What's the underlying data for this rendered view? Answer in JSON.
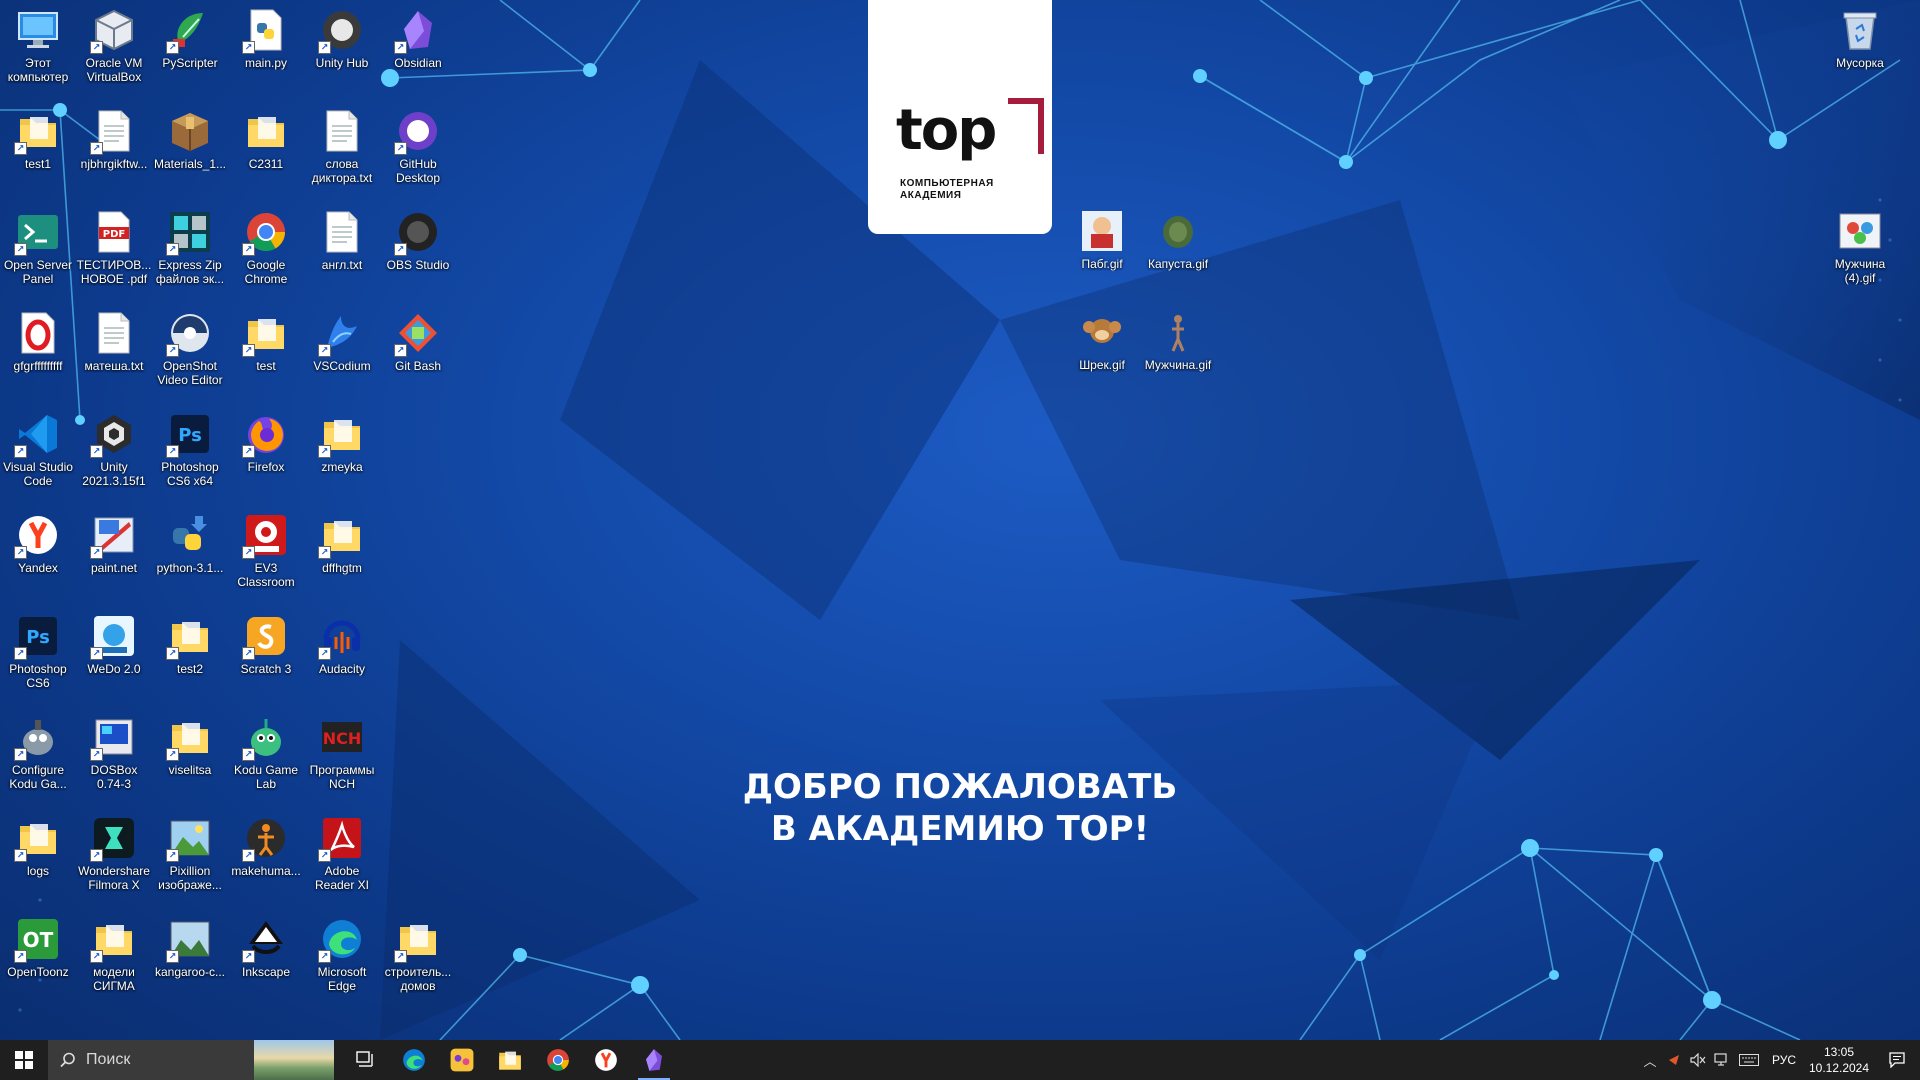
{
  "logo": {
    "word": "top",
    "subtitle_line1": "КОМПЬЮТЕРНАЯ",
    "subtitle_line2": "АКАДЕМИЯ",
    "accent": "#a61c3c"
  },
  "welcome": {
    "line1": "ДОБРО ПОЖАЛОВАТЬ",
    "line2": "В АКАДЕМИЮ TOP!"
  },
  "desktop_icons": [
    {
      "label": "Этот компьютер",
      "icon": "computer-icon",
      "col": 0,
      "row": 0,
      "shortcut": false
    },
    {
      "label": "Oracle VM VirtualBox",
      "icon": "virtualbox-icon",
      "col": 1,
      "row": 0,
      "shortcut": true
    },
    {
      "label": "PyScripter",
      "icon": "pyscripter-icon",
      "col": 2,
      "row": 0,
      "shortcut": true
    },
    {
      "label": "main.py",
      "icon": "python-file-icon",
      "col": 3,
      "row": 0,
      "shortcut": true
    },
    {
      "label": "Unity Hub",
      "icon": "unity-hub-icon",
      "col": 4,
      "row": 0,
      "shortcut": true
    },
    {
      "label": "Obsidian",
      "icon": "obsidian-icon",
      "col": 5,
      "row": 0,
      "shortcut": true
    },
    {
      "label": "test1",
      "icon": "folder-icon",
      "col": 0,
      "row": 1,
      "shortcut": true
    },
    {
      "label": "njbhrgikftw...",
      "icon": "document-icon",
      "col": 1,
      "row": 1,
      "shortcut": true
    },
    {
      "label": "Materials_1...",
      "icon": "archive-icon",
      "col": 2,
      "row": 1,
      "shortcut": false
    },
    {
      "label": "C2311",
      "icon": "folder-icon",
      "col": 3,
      "row": 1,
      "shortcut": false
    },
    {
      "label": "слова диктора.txt",
      "icon": "text-file-icon",
      "col": 4,
      "row": 1,
      "shortcut": false
    },
    {
      "label": "GitHub Desktop",
      "icon": "github-icon",
      "col": 5,
      "row": 1,
      "shortcut": true
    },
    {
      "label": "Open Server Panel",
      "icon": "terminal-icon",
      "col": 0,
      "row": 2,
      "shortcut": true
    },
    {
      "label": "ТЕСТИРОВ... НОВОЕ .pdf",
      "icon": "pdf-icon",
      "col": 1,
      "row": 2,
      "shortcut": false
    },
    {
      "label": "Express Zip файлов эк...",
      "icon": "zip-icon",
      "col": 2,
      "row": 2,
      "shortcut": true
    },
    {
      "label": "Google Chrome",
      "icon": "chrome-icon",
      "col": 3,
      "row": 2,
      "shortcut": true
    },
    {
      "label": "англ.txt",
      "icon": "text-file-icon",
      "col": 4,
      "row": 2,
      "shortcut": false
    },
    {
      "label": "OBS Studio",
      "icon": "obs-icon",
      "col": 5,
      "row": 2,
      "shortcut": true
    },
    {
      "label": "gfgrfffffffff",
      "icon": "opera-icon",
      "col": 0,
      "row": 3,
      "shortcut": false
    },
    {
      "label": "матеша.txt",
      "icon": "text-file-icon",
      "col": 1,
      "row": 3,
      "shortcut": false
    },
    {
      "label": "OpenShot Video Editor",
      "icon": "openshot-icon",
      "col": 2,
      "row": 3,
      "shortcut": true
    },
    {
      "label": "test",
      "icon": "folder-icon",
      "col": 3,
      "row": 3,
      "shortcut": true
    },
    {
      "label": "VSCodium",
      "icon": "vscodium-icon",
      "col": 4,
      "row": 3,
      "shortcut": true
    },
    {
      "label": "Git Bash",
      "icon": "git-bash-icon",
      "col": 5,
      "row": 3,
      "shortcut": true
    },
    {
      "label": "Visual Studio Code",
      "icon": "vscode-icon",
      "col": 0,
      "row": 4,
      "shortcut": true
    },
    {
      "label": "Unity 2021.3.15f1",
      "icon": "unity-icon",
      "col": 1,
      "row": 4,
      "shortcut": true
    },
    {
      "label": "Photoshop CS6 x64",
      "icon": "photoshop-icon",
      "col": 2,
      "row": 4,
      "shortcut": true
    },
    {
      "label": "Firefox",
      "icon": "firefox-icon",
      "col": 3,
      "row": 4,
      "shortcut": true
    },
    {
      "label": "zmeyka",
      "icon": "folder-icon",
      "col": 4,
      "row": 4,
      "shortcut": true
    },
    {
      "label": "Yandex",
      "icon": "yandex-icon",
      "col": 0,
      "row": 5,
      "shortcut": true
    },
    {
      "label": "paint.net",
      "icon": "paintnet-icon",
      "col": 1,
      "row": 5,
      "shortcut": true
    },
    {
      "label": "python-3.1...",
      "icon": "python-installer-icon",
      "col": 2,
      "row": 5,
      "shortcut": false
    },
    {
      "label": "EV3 Classroom",
      "icon": "ev3-icon",
      "col": 3,
      "row": 5,
      "shortcut": true
    },
    {
      "label": "dffhgtm",
      "icon": "folder-icon",
      "col": 4,
      "row": 5,
      "shortcut": true
    },
    {
      "label": "Photoshop CS6",
      "icon": "photoshop-icon",
      "col": 0,
      "row": 6,
      "shortcut": true
    },
    {
      "label": "WeDo 2.0",
      "icon": "wedo-icon",
      "col": 1,
      "row": 6,
      "shortcut": true
    },
    {
      "label": "test2",
      "icon": "folder-icon",
      "col": 2,
      "row": 6,
      "shortcut": true
    },
    {
      "label": "Scratch 3",
      "icon": "scratch-icon",
      "col": 3,
      "row": 6,
      "shortcut": true
    },
    {
      "label": "Audacity",
      "icon": "audacity-icon",
      "col": 4,
      "row": 6,
      "shortcut": true
    },
    {
      "label": "Configure Kodu Ga...",
      "icon": "kodu-config-icon",
      "col": 0,
      "row": 7,
      "shortcut": true
    },
    {
      "label": "DOSBox 0.74-3",
      "icon": "dosbox-icon",
      "col": 1,
      "row": 7,
      "shortcut": true
    },
    {
      "label": "viselitsa",
      "icon": "folder-icon",
      "col": 2,
      "row": 7,
      "shortcut": true
    },
    {
      "label": "Kodu Game Lab",
      "icon": "kodu-icon",
      "col": 3,
      "row": 7,
      "shortcut": true
    },
    {
      "label": "Программы NCH",
      "icon": "nch-icon",
      "col": 4,
      "row": 7,
      "shortcut": false
    },
    {
      "label": "logs",
      "icon": "folder-icon",
      "col": 0,
      "row": 8,
      "shortcut": true
    },
    {
      "label": "Wondershare Filmora X",
      "icon": "filmora-icon",
      "col": 1,
      "row": 8,
      "shortcut": true
    },
    {
      "label": "Pixillion изображе...",
      "icon": "pixillion-icon",
      "col": 2,
      "row": 8,
      "shortcut": true
    },
    {
      "label": "makehuma...",
      "icon": "makehuman-icon",
      "col": 3,
      "row": 8,
      "shortcut": true
    },
    {
      "label": "Adobe Reader XI",
      "icon": "acrobat-icon",
      "col": 4,
      "row": 8,
      "shortcut": true
    },
    {
      "label": "OpenToonz",
      "icon": "opentoonz-icon",
      "col": 0,
      "row": 9,
      "shortcut": true
    },
    {
      "label": "модели СИГМА",
      "icon": "folder-icon",
      "col": 1,
      "row": 9,
      "shortcut": true
    },
    {
      "label": "kangaroo-c...",
      "icon": "image-file-icon",
      "col": 2,
      "row": 9,
      "shortcut": true
    },
    {
      "label": "Inkscape",
      "icon": "inkscape-icon",
      "col": 3,
      "row": 9,
      "shortcut": true
    },
    {
      "label": "Microsoft Edge",
      "icon": "edge-icon",
      "col": 4,
      "row": 9,
      "shortcut": true
    },
    {
      "label": "строитель... домов",
      "icon": "folder-icon",
      "col": 5,
      "row": 9,
      "shortcut": true
    }
  ],
  "free_icons": [
    {
      "label": "Пабг.gif",
      "icon": "gif-pubg-icon",
      "slot": "a"
    },
    {
      "label": "Капуста.gif",
      "icon": "gif-cabbage-icon",
      "slot": "b"
    },
    {
      "label": "Шрек.gif",
      "icon": "gif-shrek-icon",
      "slot": "c"
    },
    {
      "label": "Мужчина.gif",
      "icon": "gif-man-icon",
      "slot": "d"
    },
    {
      "label": "Мусорка",
      "icon": "recycle-bin-icon",
      "slot": "e"
    },
    {
      "label": "Мужчина (4).gif",
      "icon": "gif-man2-icon",
      "slot": "f"
    }
  ],
  "taskbar": {
    "search_placeholder": "Поиск",
    "pinned": [
      {
        "name": "task-view",
        "icon": "task-view-icon"
      },
      {
        "name": "edge",
        "icon": "edge-icon"
      },
      {
        "name": "games",
        "icon": "game-app-icon"
      },
      {
        "name": "explorer",
        "icon": "folder-icon"
      },
      {
        "name": "chrome",
        "icon": "chrome-icon"
      },
      {
        "name": "yandex",
        "icon": "yandex-icon"
      },
      {
        "name": "obsidian",
        "icon": "obsidian-icon",
        "active": true
      }
    ],
    "tray": {
      "language": "РУС",
      "time": "13:05",
      "date": "10.12.2024"
    }
  },
  "colors": {
    "bg_dark": "#0a2d6e",
    "bg_light": "#1d5bc4",
    "line": "#5fc8ff",
    "taskbar": "#1f1f1f"
  }
}
